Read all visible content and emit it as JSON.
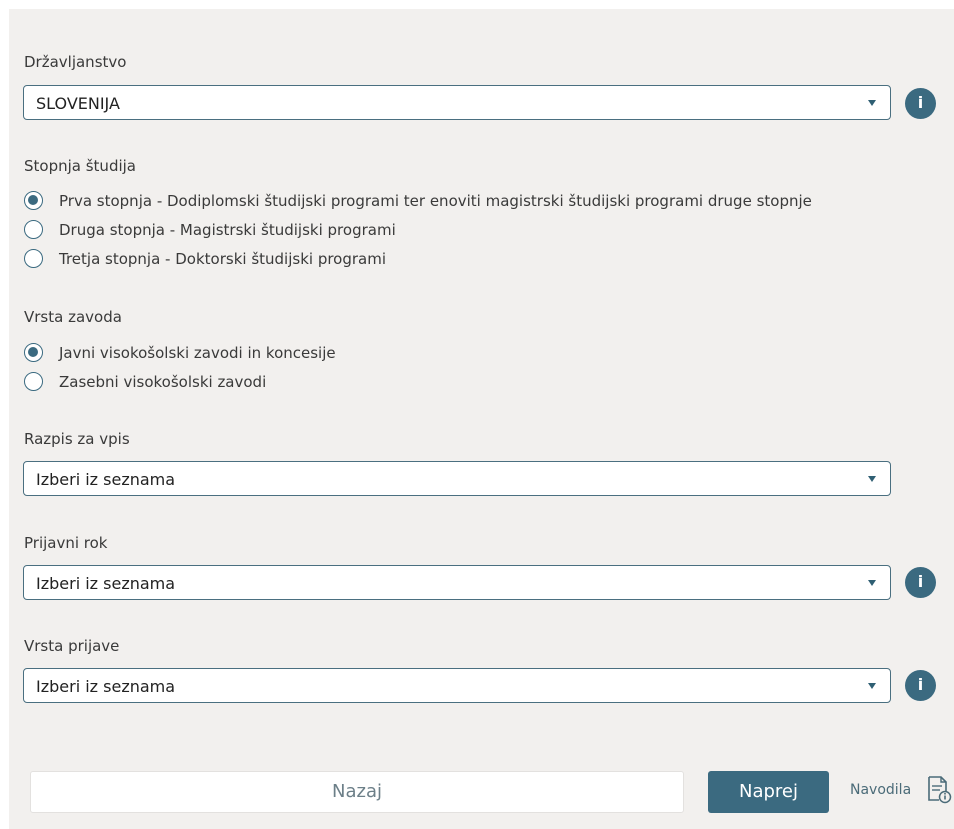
{
  "citizenship": {
    "label": "Državljanstvo",
    "value": "SLOVENIJA",
    "info_icon": "info-icon"
  },
  "study_level": {
    "label": "Stopnja študija",
    "options": [
      "Prva stopnja - Dodiplomski študijski programi ter enoviti magistrski študijski programi druge stopnje",
      "Druga stopnja - Magistrski študijski programi",
      "Tretja stopnja - Doktorski študijski programi"
    ],
    "selected": 0
  },
  "institution_type": {
    "label": "Vrsta zavoda",
    "options": [
      "Javni visokošolski zavodi in koncesije",
      "Zasebni visokošolski zavodi"
    ],
    "selected": 0
  },
  "call_for_enrollment": {
    "label": "Razpis za vpis",
    "value": "Izberi iz seznama"
  },
  "application_period": {
    "label": "Prijavni rok",
    "value": "Izberi iz seznama",
    "info_icon": "info-icon"
  },
  "application_type": {
    "label": "Vrsta prijave",
    "value": "Izberi iz seznama",
    "info_icon": "info-icon"
  },
  "footer": {
    "back_label": "Nazaj",
    "next_label": "Naprej",
    "guide_label": "Navodila",
    "guide_icon": "document-info-icon"
  },
  "colors": {
    "accent": "#3b6a80",
    "panel_background": "#f2f0ee",
    "select_border": "#4a6f80"
  }
}
